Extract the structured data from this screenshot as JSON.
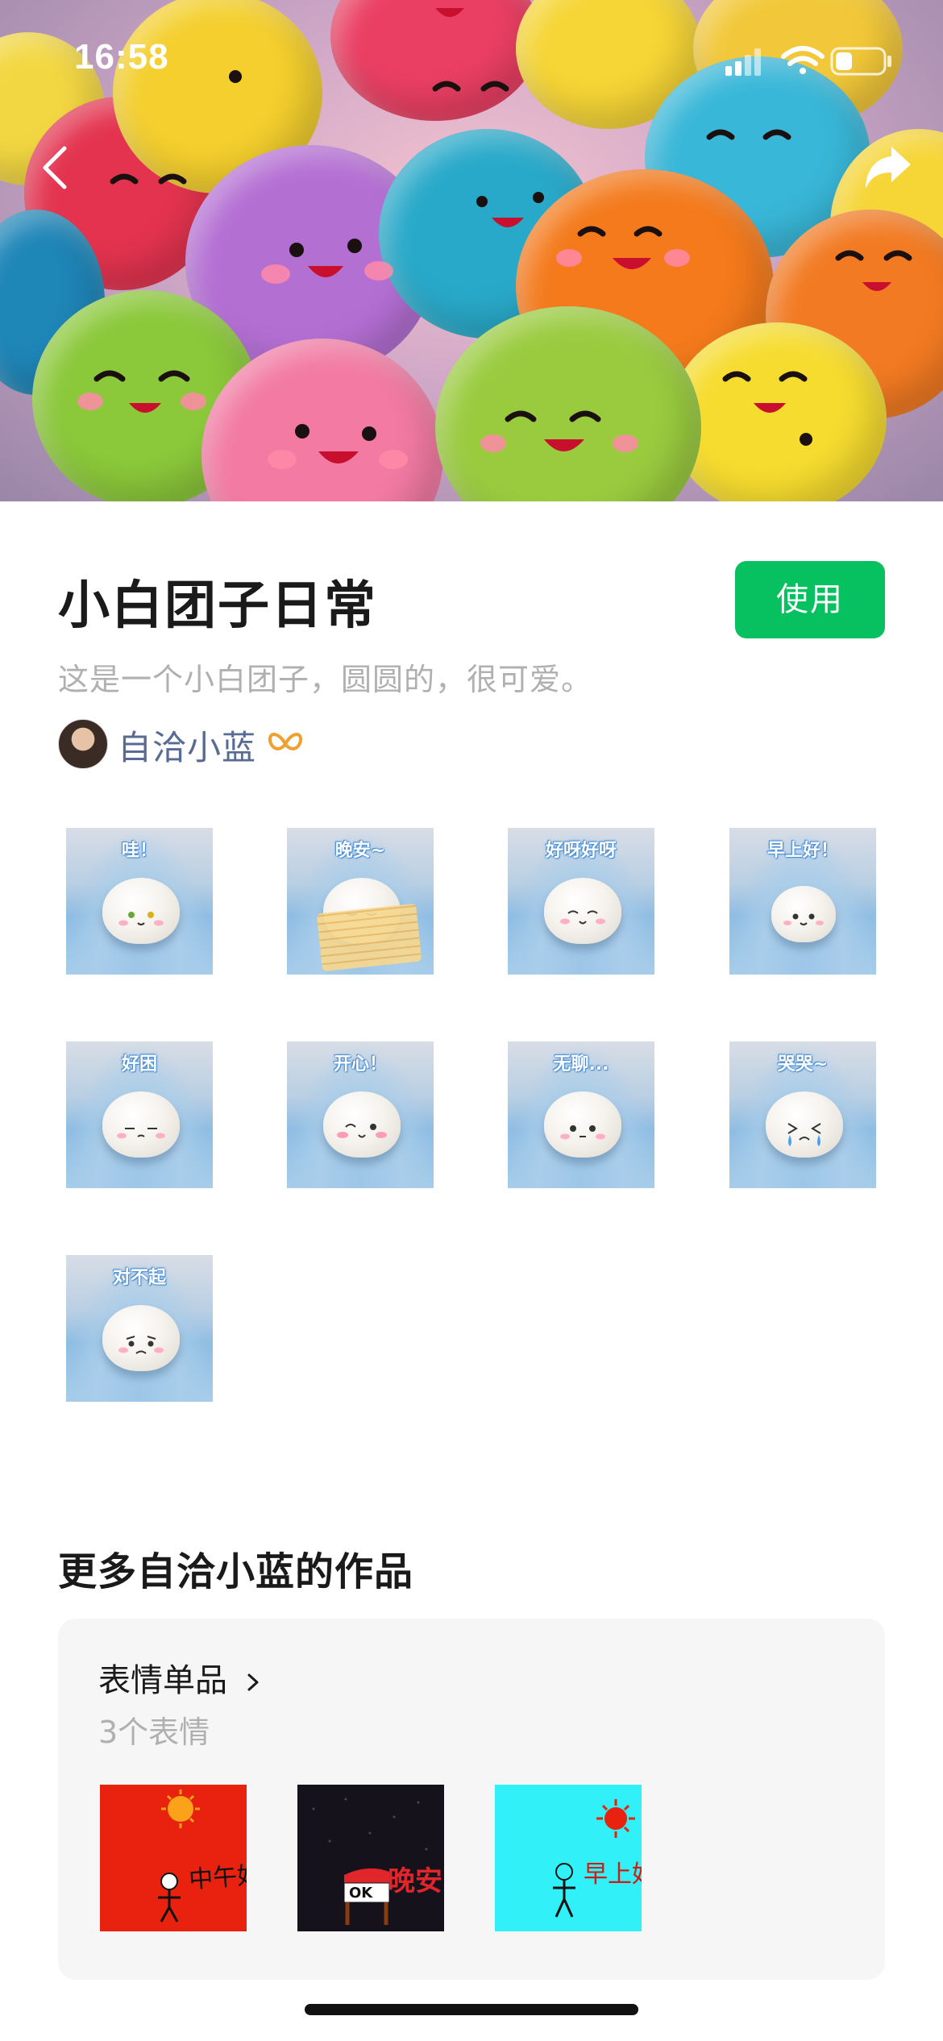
{
  "status_bar": {
    "time": "16:58"
  },
  "pack": {
    "title": "小白团子日常",
    "use_label": "使用",
    "description": "这是一个小白团子，圆圆的，很可爱。",
    "author": "自洽小蓝"
  },
  "stickers": [
    {
      "text": "哇！"
    },
    {
      "text": "晚安~"
    },
    {
      "text": "好呀好呀"
    },
    {
      "text": "早上好！"
    },
    {
      "text": "好困"
    },
    {
      "text": "开心！"
    },
    {
      "text": "无聊..."
    },
    {
      "text": "哭哭~"
    },
    {
      "text": "对不起"
    }
  ],
  "more": {
    "title": "更多自洽小蓝的作品",
    "card_title": "表情单品",
    "card_count": "3个表情",
    "items": [
      {
        "text": "中午好",
        "bg": "#e8220e"
      },
      {
        "text": "晚安",
        "bg": "#16121c"
      },
      {
        "text": "早上好",
        "bg": "#31f0f7"
      }
    ]
  },
  "colors": {
    "accent_green": "#07c160",
    "author_blue": "#576b95",
    "muted_gray": "#b0b0b0"
  },
  "icons": [
    "back-arrow-icon",
    "share-icon",
    "signal-icon",
    "wifi-icon",
    "battery-icon",
    "author-badge-icon",
    "chevron-right-icon"
  ]
}
